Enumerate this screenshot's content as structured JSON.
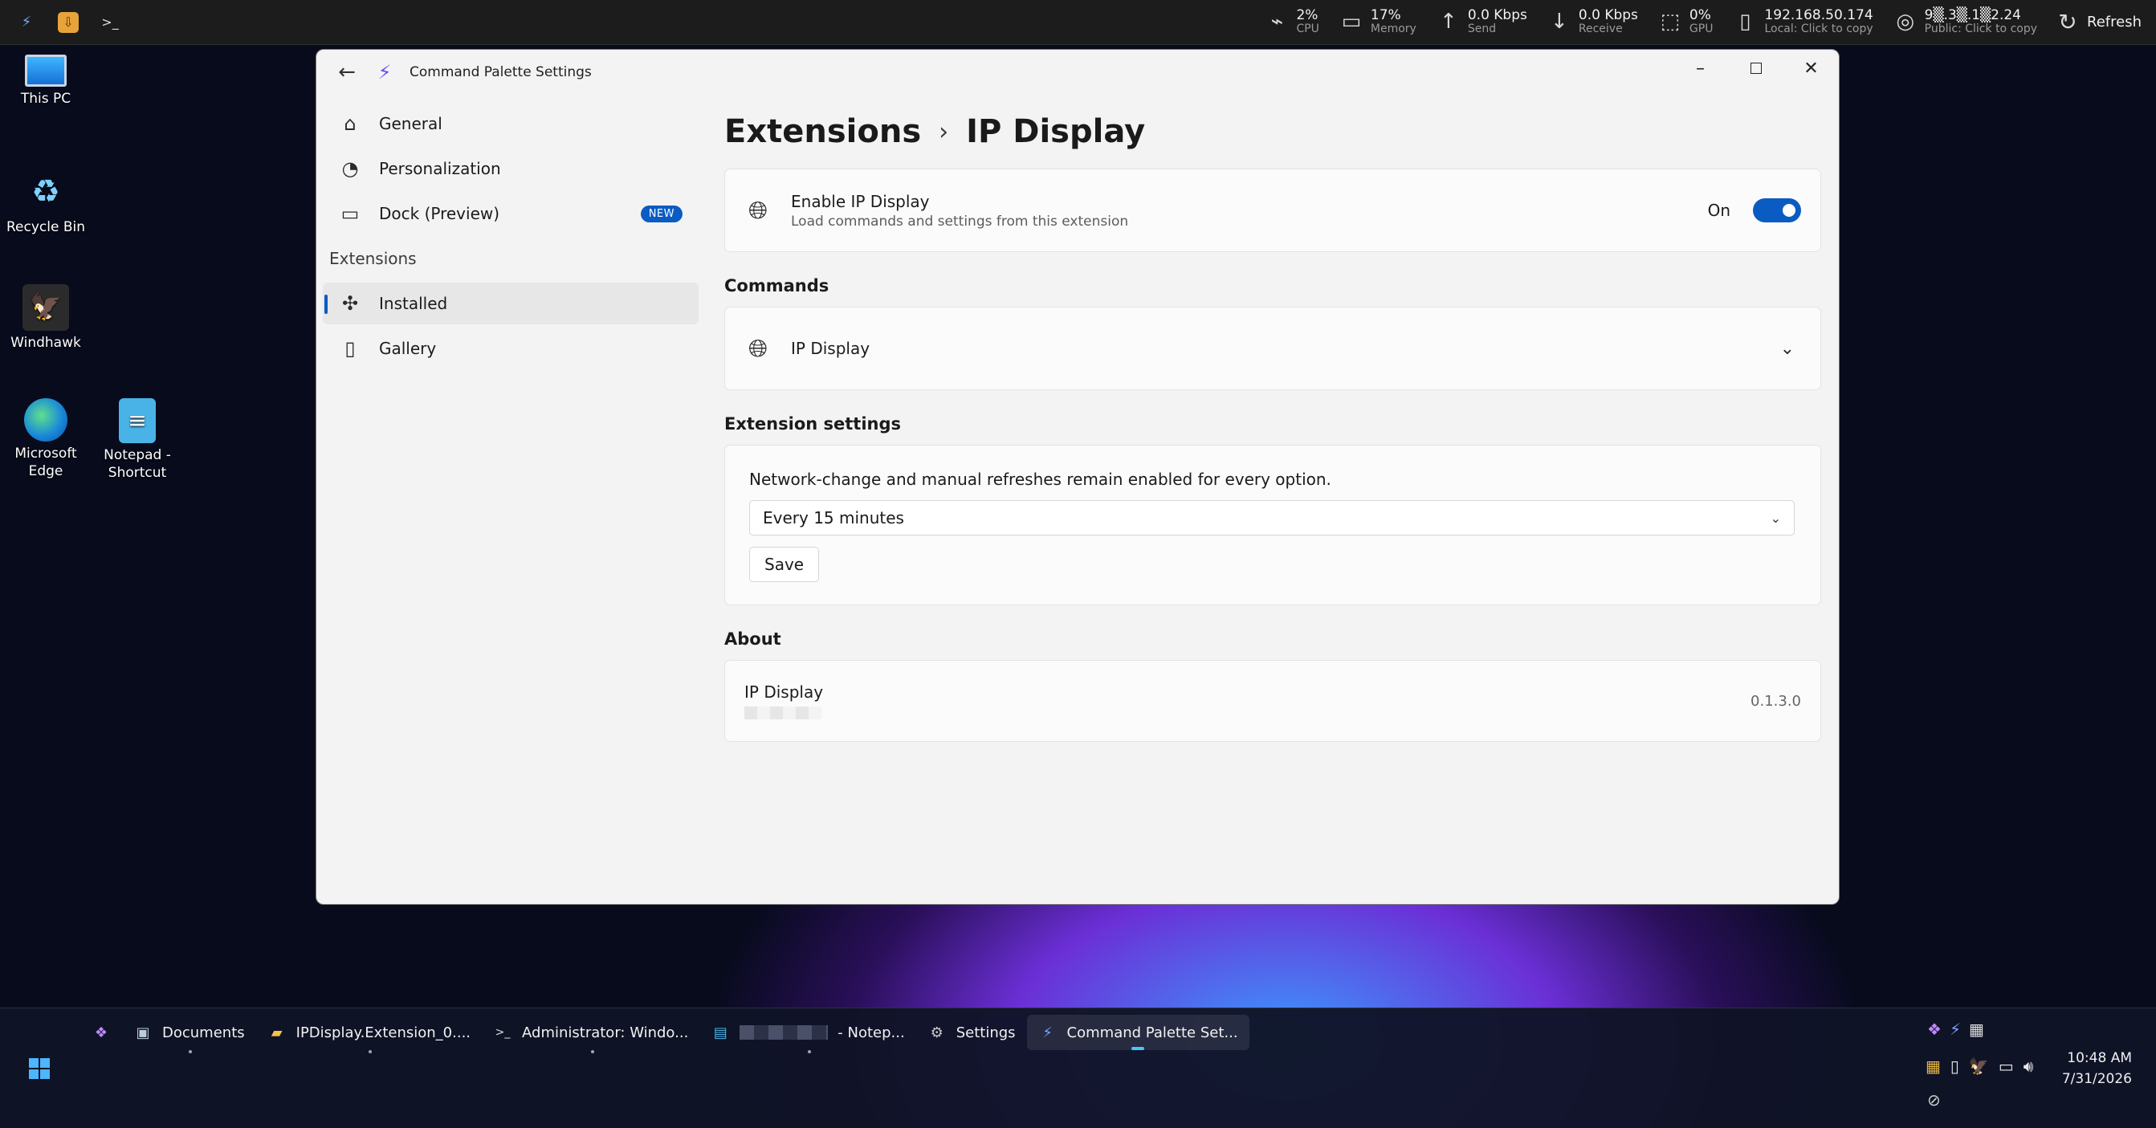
{
  "topbar": {
    "stats": [
      {
        "glyph": "⌁",
        "value": "2%",
        "label": "CPU",
        "icon": "cpu-activity-icon"
      },
      {
        "glyph": "▭",
        "value": "17%",
        "label": "Memory",
        "icon": "memory-icon"
      },
      {
        "glyph": "↑",
        "value": "0.0 Kbps",
        "label": "Send",
        "icon": "upload-arrow-icon"
      },
      {
        "glyph": "↓",
        "value": "0.0 Kbps",
        "label": "Receive",
        "icon": "download-arrow-icon"
      },
      {
        "glyph": "⬚",
        "value": "0%",
        "label": "GPU",
        "icon": "gpu-chip-icon"
      },
      {
        "glyph": "▯",
        "value": "192.168.50.174",
        "label": "Local: Click to copy",
        "icon": "local-network-icon"
      },
      {
        "glyph": "◎",
        "value": "9▒.3▒.1▒2.24",
        "label": "Public: Click to copy",
        "icon": "globe-icon"
      }
    ],
    "refresh_label": "Refresh"
  },
  "desktop": {
    "icons": [
      {
        "label": "This PC"
      },
      {
        "label": "Recycle Bin"
      },
      {
        "label": "Windhawk"
      },
      {
        "label": "Microsoft Edge"
      },
      {
        "label": "Notepad - Shortcut"
      }
    ]
  },
  "window": {
    "title": "Command Palette Settings",
    "sidebar": {
      "items": [
        {
          "label": "General"
        },
        {
          "label": "Personalization"
        },
        {
          "label": "Dock (Preview)",
          "badge": "NEW"
        }
      ],
      "section_label": "Extensions",
      "ext_items": [
        {
          "label": "Installed"
        },
        {
          "label": "Gallery"
        }
      ]
    },
    "breadcrumb": {
      "parent": "Extensions",
      "current": "IP Display"
    },
    "enable_card": {
      "title": "Enable IP Display",
      "description": "Load commands and settings from this extension",
      "toggle_label": "On"
    },
    "commands": {
      "header": "Commands",
      "items": [
        {
          "label": "IP Display"
        }
      ]
    },
    "ext_settings": {
      "header": "Extension settings",
      "description": "Network-change and manual refreshes remain enabled for every option.",
      "selected_option": "Every 15 minutes",
      "save_label": "Save"
    },
    "about": {
      "header": "About",
      "name": "IP Display",
      "version": "0.1.3.0"
    }
  },
  "taskbar": {
    "tasks": [
      {
        "label": "Documents"
      },
      {
        "label": "IPDisplay.Extension_0...."
      },
      {
        "label": "Administrator: Windo..."
      },
      {
        "label": "- Notep..."
      },
      {
        "label": "Settings"
      },
      {
        "label": "Command Palette Set..."
      }
    ],
    "time": "10:48 AM",
    "date": "7/31/2026"
  },
  "colors": {
    "accent": "#0a5cc2",
    "window_bg": "#f3f3f3",
    "card_bg": "#fbfbfb",
    "taskbar_bg": "#101426"
  }
}
